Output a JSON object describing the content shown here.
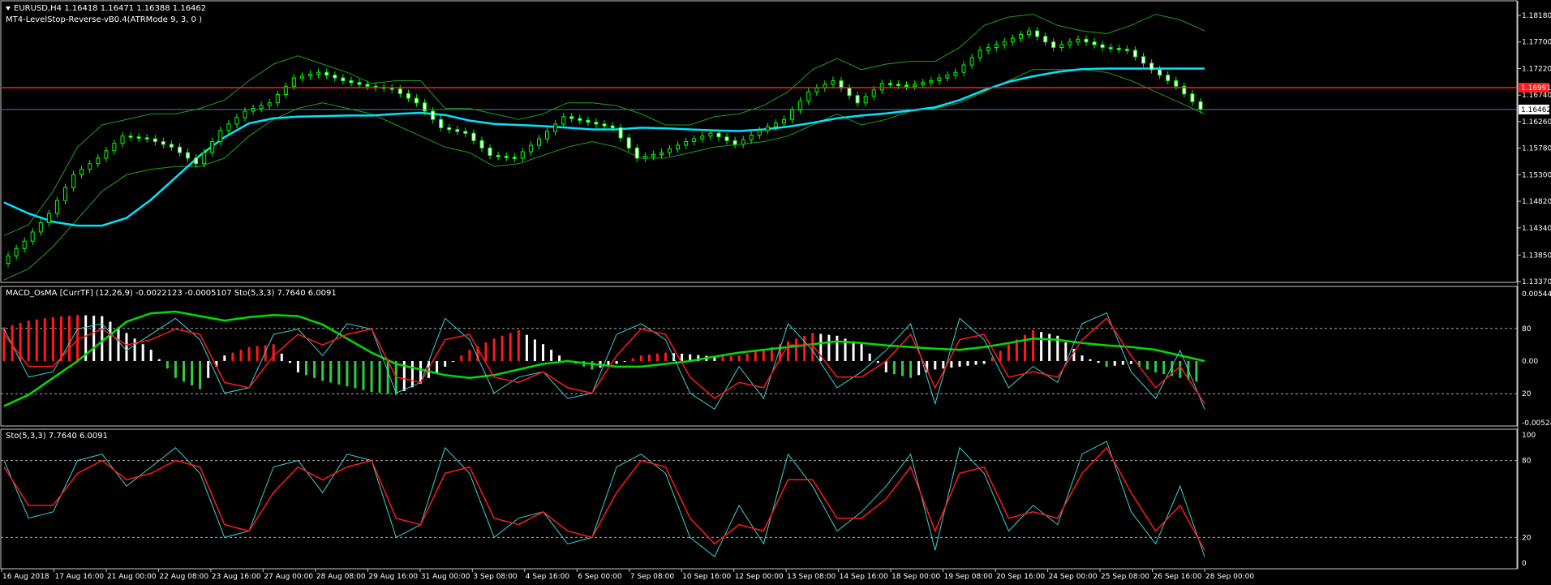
{
  "main": {
    "symbol_line": "EURUSD,H4  1.16418 1.16471 1.16388 1.16462",
    "indicator_line": "MT4-LevelStop-Reverse-vB0.4(ATRMode 9, 3, 0 )",
    "y_ticks": [
      "1.18180",
      "1.17700",
      "1.17220",
      "1.16740",
      "1.16260",
      "1.15780",
      "1.15300",
      "1.14820",
      "1.14340",
      "1.13850",
      "1.13370"
    ],
    "red_level": "1.16991",
    "current_price": "1.16462"
  },
  "macd": {
    "label": "MACD_OsMA [CurrTF] (12,26,9) -0.0022123 -0.0005107  Sto(5,3,3) 7.7640 6.0091",
    "ticks": [
      "0.005447",
      "80",
      "0.00",
      "20",
      "-0.005244"
    ]
  },
  "stoch": {
    "label": "Sto(5,3,3) 7.7640 6.0091",
    "ticks": [
      "100",
      "80",
      "20",
      "0"
    ]
  },
  "x_ticks": [
    "16 Aug 2018",
    "17 Aug 16:00",
    "21 Aug 00:00",
    "22 Aug 08:00",
    "23 Aug 16:00",
    "27 Aug 00:00",
    "28 Aug 08:00",
    "29 Aug 16:00",
    "31 Aug 00:00",
    "3 Sep 08:00",
    "4 Sep 16:00",
    "6 Sep 00:00",
    "7 Sep 08:00",
    "10 Sep 16:00",
    "12 Sep 00:00",
    "13 Sep 08:00",
    "14 Sep 16:00",
    "18 Sep 00:00",
    "19 Sep 08:00",
    "20 Sep 16:00",
    "24 Sep 00:00",
    "25 Sep 08:00",
    "26 Sep 16:00",
    "28 Sep 00:00"
  ],
  "chart_data": {
    "type": "line",
    "series": [
      {
        "kind": "close",
        "color": "#00ff00",
        "values": [
          1.137,
          1.141,
          1.146,
          1.153,
          1.156,
          1.16,
          1.1595,
          1.158,
          1.155,
          1.161,
          1.1645,
          1.166,
          1.1705,
          1.1715,
          1.17,
          1.169,
          1.1685,
          1.166,
          1.1615,
          1.1605,
          1.1565,
          1.156,
          1.1595,
          1.1635,
          1.1625,
          1.1615,
          1.156,
          1.157,
          1.159,
          1.1605,
          1.1585,
          1.161,
          1.163,
          1.168,
          1.17,
          1.166,
          1.1695,
          1.169,
          1.17,
          1.1715,
          1.1755,
          1.177,
          1.179,
          1.176,
          1.1775,
          1.176,
          1.1755,
          1.172,
          1.169,
          1.1648
        ]
      },
      {
        "kind": "moving-average",
        "color": "#00e5ff",
        "values": [
          1.148,
          1.146,
          1.1445,
          1.1438,
          1.1438,
          1.1452,
          1.1485,
          1.1525,
          1.1565,
          1.1598,
          1.1623,
          1.1632,
          1.1635,
          1.1636,
          1.1637,
          1.1637,
          1.164,
          1.1642,
          1.1638,
          1.1628,
          1.1622,
          1.162,
          1.1618,
          1.1615,
          1.1612,
          1.1612,
          1.1615,
          1.1614,
          1.1612,
          1.161,
          1.1609,
          1.1612,
          1.1617,
          1.1624,
          1.1632,
          1.1637,
          1.1641,
          1.1646,
          1.1652,
          1.1665,
          1.1683,
          1.1698,
          1.1708,
          1.1716,
          1.1721,
          1.1722,
          1.1722,
          1.1722,
          1.1722,
          1.1722
        ]
      },
      {
        "kind": "upper-band",
        "color": "#1f9e1f",
        "values": [
          1.142,
          1.144,
          1.15,
          1.158,
          1.162,
          1.163,
          1.164,
          1.164,
          1.165,
          1.1665,
          1.17,
          1.173,
          1.1745,
          1.173,
          1.1715,
          1.1695,
          1.17,
          1.17,
          1.165,
          1.165,
          1.164,
          1.163,
          1.164,
          1.166,
          1.166,
          1.1655,
          1.164,
          1.162,
          1.162,
          1.1635,
          1.164,
          1.1655,
          1.168,
          1.172,
          1.174,
          1.172,
          1.173,
          1.1735,
          1.1735,
          1.176,
          1.18,
          1.1815,
          1.182,
          1.18,
          1.179,
          1.1785,
          1.18,
          1.182,
          1.181,
          1.179
        ]
      },
      {
        "kind": "lower-band",
        "color": "#1f9e1f",
        "values": [
          1.134,
          1.136,
          1.14,
          1.145,
          1.15,
          1.153,
          1.154,
          1.1545,
          1.1545,
          1.156,
          1.16,
          1.163,
          1.165,
          1.166,
          1.165,
          1.164,
          1.162,
          1.16,
          1.158,
          1.157,
          1.1545,
          1.155,
          1.1565,
          1.158,
          1.159,
          1.158,
          1.156,
          1.156,
          1.157,
          1.158,
          1.1585,
          1.159,
          1.16,
          1.162,
          1.164,
          1.162,
          1.163,
          1.1645,
          1.165,
          1.166,
          1.168,
          1.17,
          1.172,
          1.172,
          1.172,
          1.1715,
          1.17,
          1.168,
          1.166,
          1.164
        ]
      },
      {
        "kind": "macd-histogram",
        "values": [
          0.6,
          0.72,
          0.78,
          0.82,
          0.8,
          0.5,
          0.2,
          -0.3,
          -0.5,
          0.1,
          0.25,
          0.3,
          -0.2,
          -0.35,
          -0.45,
          -0.55,
          -0.6,
          -0.4,
          -0.1,
          0.2,
          0.4,
          0.55,
          0.3,
          0.0,
          -0.15,
          -0.05,
          0.1,
          0.15,
          0.12,
          0.08,
          0.1,
          0.2,
          0.35,
          0.5,
          0.45,
          0.3,
          -0.2,
          -0.3,
          -0.15,
          -0.1,
          -0.05,
          0.3,
          0.55,
          0.45,
          0.1,
          -0.1,
          -0.05,
          -0.2,
          -0.3,
          -0.4
        ]
      },
      {
        "kind": "macd-signal",
        "color": "#00dd00",
        "values": [
          -0.8,
          -0.6,
          -0.3,
          0.0,
          0.35,
          0.7,
          0.85,
          0.88,
          0.8,
          0.72,
          0.78,
          0.82,
          0.8,
          0.65,
          0.4,
          0.15,
          -0.05,
          -0.15,
          -0.25,
          -0.3,
          -0.25,
          -0.15,
          -0.05,
          0.0,
          -0.05,
          -0.1,
          -0.1,
          -0.05,
          0.0,
          0.08,
          0.15,
          0.2,
          0.25,
          0.3,
          0.35,
          0.32,
          0.28,
          0.25,
          0.22,
          0.2,
          0.25,
          0.32,
          0.4,
          0.38,
          0.32,
          0.28,
          0.25,
          0.2,
          0.1,
          0.0
        ]
      }
    ],
    "stochastic": {
      "ylim": [
        0,
        100
      ],
      "levels": [
        20,
        80
      ],
      "k": [
        80,
        35,
        40,
        80,
        85,
        60,
        75,
        90,
        70,
        20,
        25,
        75,
        80,
        55,
        85,
        80,
        20,
        30,
        90,
        70,
        20,
        35,
        40,
        15,
        20,
        75,
        85,
        70,
        20,
        5,
        45,
        15,
        85,
        60,
        25,
        40,
        60,
        85,
        10,
        90,
        70,
        25,
        45,
        30,
        85,
        95,
        40,
        15,
        60,
        5
      ],
      "d": [
        75,
        45,
        45,
        70,
        80,
        65,
        70,
        80,
        75,
        30,
        25,
        55,
        75,
        65,
        75,
        80,
        35,
        30,
        70,
        75,
        35,
        30,
        40,
        25,
        20,
        55,
        80,
        75,
        35,
        15,
        30,
        25,
        65,
        65,
        35,
        35,
        50,
        75,
        25,
        70,
        75,
        35,
        40,
        35,
        70,
        90,
        55,
        25,
        45,
        10
      ]
    },
    "ylim": [
      1.1337,
      1.1818
    ],
    "grid": false
  }
}
